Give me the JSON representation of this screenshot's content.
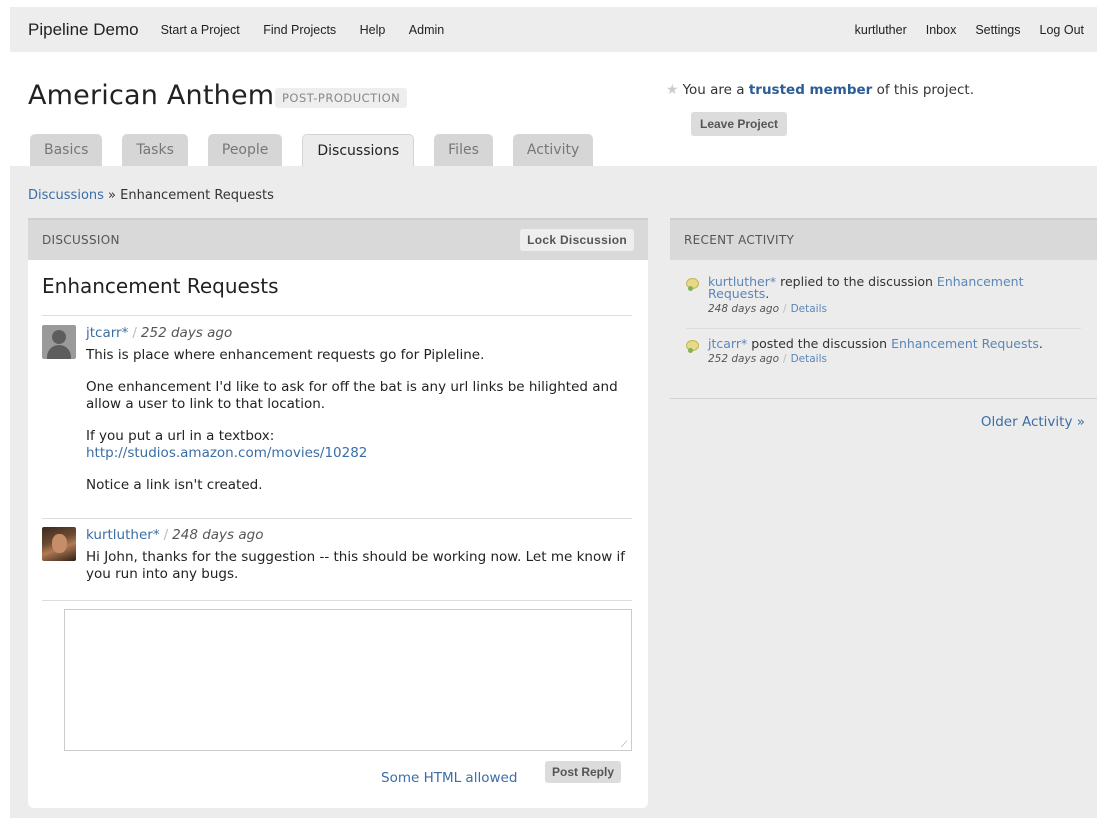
{
  "nav": {
    "brand": "Pipeline Demo",
    "left_links": [
      "Start a Project",
      "Find Projects",
      "Help",
      "Admin"
    ],
    "right_links": [
      "kurtluther",
      "Inbox",
      "Settings",
      "Log Out"
    ]
  },
  "project": {
    "title": "American Anthem",
    "stage": "POST-PRODUCTION",
    "membership_prefix": "You are a",
    "membership_role": "trusted member",
    "membership_suffix": "of this project.",
    "leave_label": "Leave Project"
  },
  "tabs": [
    {
      "label": "Basics"
    },
    {
      "label": "Tasks"
    },
    {
      "label": "People"
    },
    {
      "label": "Discussions",
      "active": true
    },
    {
      "label": "Files"
    },
    {
      "label": "Activity"
    }
  ],
  "breadcrumb": {
    "parent": "Discussions",
    "separator": "»",
    "current": "Enhancement Requests"
  },
  "discussion": {
    "header": "DISCUSSION",
    "lock_label": "Lock Discussion",
    "title": "Enhancement Requests",
    "posts": [
      {
        "author": "jtcarr*",
        "when": "252 days ago",
        "paragraphs": [
          "This is place where enhancement requests go for Pipleline.",
          "One enhancement I'd like to ask for off the bat is any url links be hilighted and allow a user to link to that location.",
          "If you put a url in a textbox:",
          "Notice a link isn't created."
        ],
        "url": "http://studios.amazon.com/movies/10282"
      },
      {
        "author": "kurtluther*",
        "when": "248 days ago",
        "paragraphs": [
          "Hi John, thanks for the suggestion -- this should be working now. Let me know if you run into any bugs."
        ]
      }
    ],
    "reply_value": "",
    "html_note": "Some HTML allowed",
    "post_label": "Post Reply"
  },
  "activity": {
    "header": "RECENT ACTIVITY",
    "items": [
      {
        "user": "kurtluther*",
        "action": "replied to the discussion",
        "target": "Enhancement Requests",
        "when": "248 days ago",
        "details": "Details"
      },
      {
        "user": "jtcarr*",
        "action": "posted the discussion",
        "target": "Enhancement Requests",
        "when": "252 days ago",
        "details": "Details"
      }
    ],
    "older_label": "Older Activity »"
  },
  "colors": {
    "link": "#3a6ea5",
    "canvas": "#ececec",
    "panel_head": "#d9d9d9"
  }
}
